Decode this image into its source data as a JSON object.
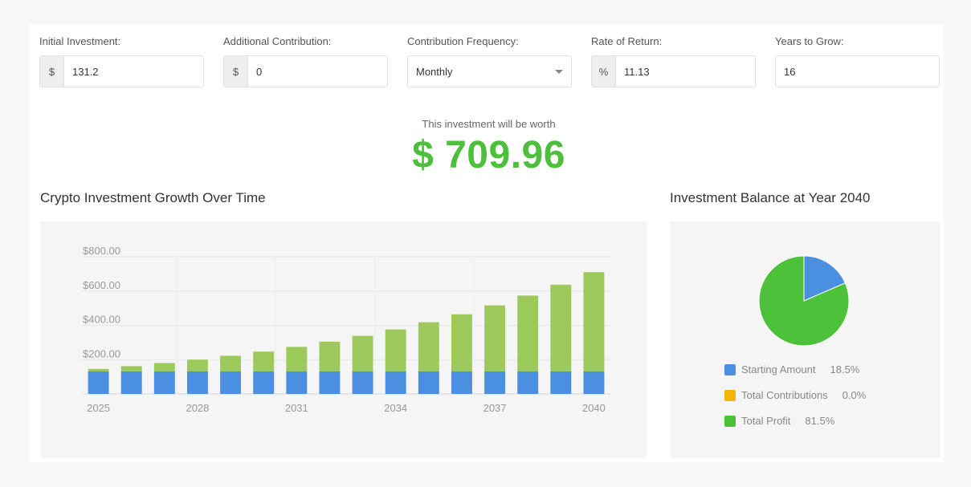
{
  "form": {
    "initial_investment": {
      "label": "Initial Investment:",
      "prefix": "$",
      "value": "131.2"
    },
    "additional_contribution": {
      "label": "Additional Contribution:",
      "prefix": "$",
      "value": "0"
    },
    "contribution_frequency": {
      "label": "Contribution Frequency:",
      "value": "Monthly"
    },
    "rate_of_return": {
      "label": "Rate of Return:",
      "prefix": "%",
      "value": "11.13"
    },
    "years_to_grow": {
      "label": "Years to Grow:",
      "value": "16"
    }
  },
  "result": {
    "caption": "This investment will be worth",
    "value": "$ 709.96"
  },
  "growth_section": {
    "title": "Crypto Investment Growth Over Time"
  },
  "balance_section": {
    "title": "Investment Balance at Year 2040"
  },
  "colors": {
    "starting": "#4a8fe0",
    "contributions": "#f2b705",
    "profit_bar": "#9cc95a",
    "profit_pie": "#4ec13a",
    "accent": "#4dbf3c"
  },
  "chart_data": [
    {
      "type": "bar",
      "stacked": true,
      "categories": [
        "2025",
        "2026",
        "2027",
        "2028",
        "2029",
        "2030",
        "2031",
        "2032",
        "2033",
        "2034",
        "2035",
        "2036",
        "2037",
        "2038",
        "2039",
        "2040"
      ],
      "tick_labels": [
        "$800.00",
        "$600.00",
        "$400.00",
        "$200.00"
      ],
      "x_tick_labels": [
        "2025",
        "2028",
        "2031",
        "2034",
        "2037",
        "2040"
      ],
      "ylim": [
        0,
        800
      ],
      "grid": true,
      "series": [
        {
          "name": "Starting Amount",
          "values": [
            131.2,
            131.2,
            131.2,
            131.2,
            131.2,
            131.2,
            131.2,
            131.2,
            131.2,
            131.2,
            131.2,
            131.2,
            131.2,
            131.2,
            131.2,
            131.2
          ]
        },
        {
          "name": "Total Profit",
          "values": [
            14.6,
            30.8,
            48.8,
            68.8,
            91.0,
            115.7,
            143.2,
            173.7,
            207.5,
            245.1,
            286.9,
            333.3,
            384.9,
            442.2,
            505.9,
            578.8
          ]
        }
      ]
    },
    {
      "type": "pie",
      "title": "Investment Balance at Year 2040",
      "slices": [
        {
          "name": "Starting Amount",
          "value": 18.5,
          "label": "18.5%"
        },
        {
          "name": "Total Contributions",
          "value": 0.0,
          "label": "0.0%"
        },
        {
          "name": "Total Profit",
          "value": 81.5,
          "label": "81.5%"
        }
      ]
    }
  ]
}
